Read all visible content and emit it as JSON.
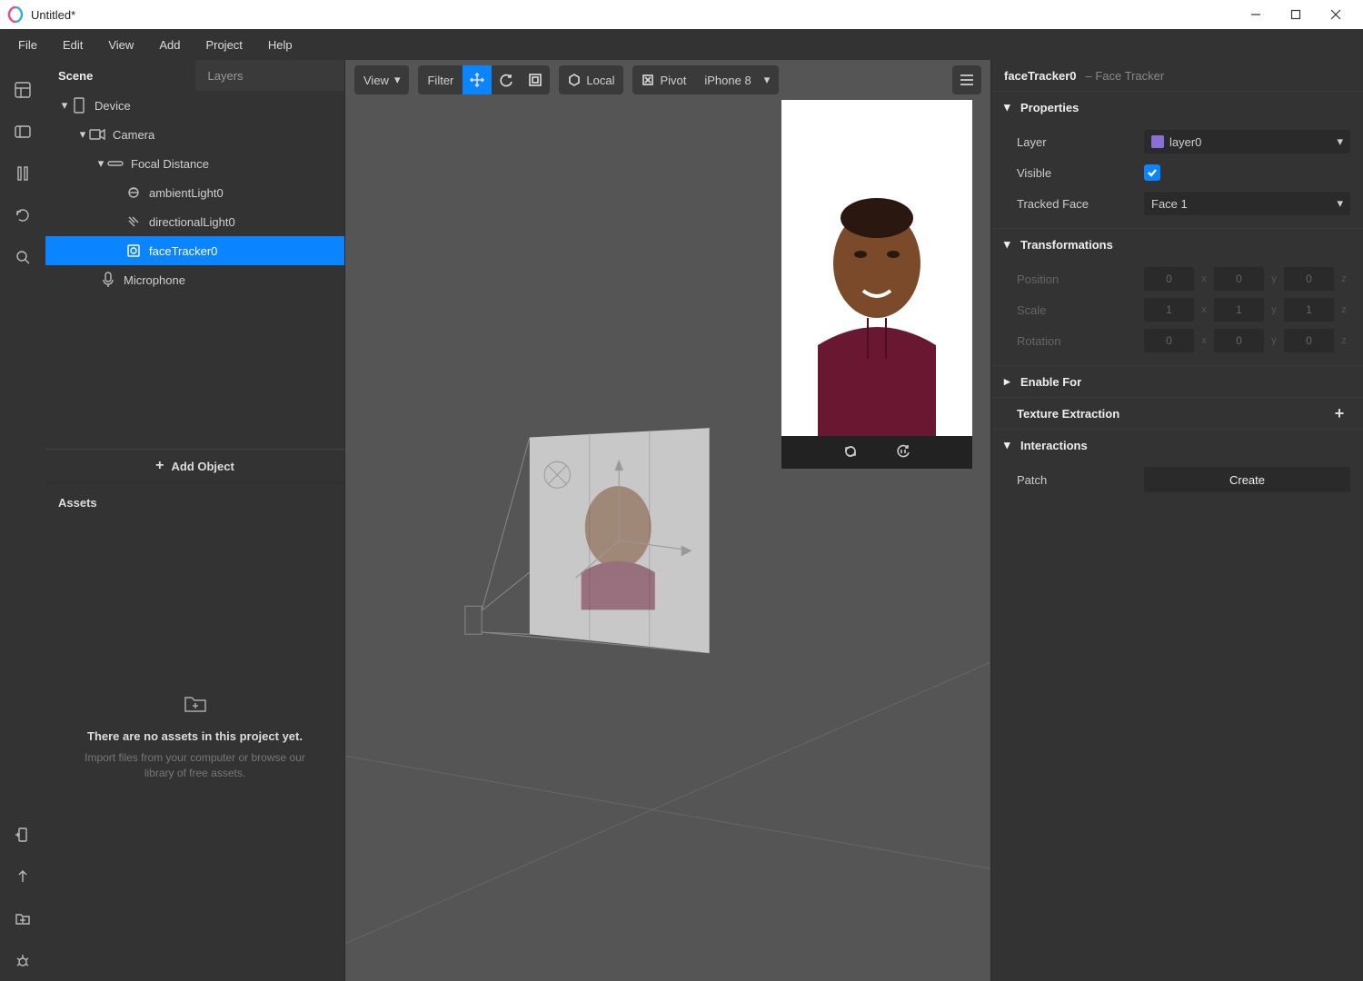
{
  "window": {
    "title": "Untitled*"
  },
  "menu": {
    "file": "File",
    "edit": "Edit",
    "view": "View",
    "add": "Add",
    "project": "Project",
    "help": "Help"
  },
  "scene": {
    "tab_scene": "Scene",
    "tab_layers": "Layers",
    "nodes": {
      "device": "Device",
      "camera": "Camera",
      "focal": "Focal Distance",
      "ambient": "ambientLight0",
      "directional": "directionalLight0",
      "facetracker": "faceTracker0",
      "microphone": "Microphone"
    },
    "add_object": "Add Object"
  },
  "assets": {
    "title": "Assets",
    "empty_title": "There are no assets in this project yet.",
    "empty_sub": "Import files from your computer or browse our library of free assets."
  },
  "viewport": {
    "view_label": "View",
    "filter_label": "Filter",
    "local_label": "Local",
    "pivot_label": "Pivot",
    "device": "iPhone 8"
  },
  "inspector": {
    "obj_name": "faceTracker0",
    "obj_type": "– Face Tracker",
    "section_properties": "Properties",
    "layer_label": "Layer",
    "layer_value": "layer0",
    "visible_label": "Visible",
    "visible": true,
    "tracked_label": "Tracked Face",
    "tracked_value": "Face 1",
    "section_transform": "Transformations",
    "position_label": "Position",
    "scale_label": "Scale",
    "rotation_label": "Rotation",
    "position": {
      "x": "0",
      "y": "0",
      "z": "0"
    },
    "scale": {
      "x": "1",
      "y": "1",
      "z": "1"
    },
    "rotation": {
      "x": "0",
      "y": "0",
      "z": "0"
    },
    "section_enable": "Enable For",
    "section_texture": "Texture Extraction",
    "section_interactions": "Interactions",
    "patch_label": "Patch",
    "create_label": "Create"
  }
}
